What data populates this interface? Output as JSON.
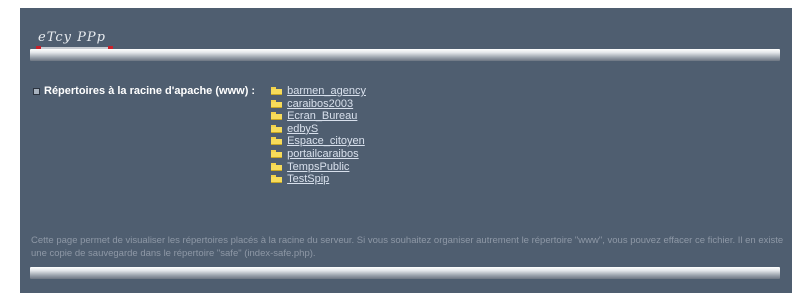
{
  "header": {
    "logo_text": "eTcy PPp",
    "colors": {
      "background": "#4f5e70",
      "accent": "#c8202a",
      "folder": "#f7dc5a"
    }
  },
  "main": {
    "section_label": "Répertoires à la racine d'apache (www) :",
    "directories": [
      {
        "label": "barmen_agency"
      },
      {
        "label": "caraibos2003"
      },
      {
        "label": "Ecran_Bureau"
      },
      {
        "label": "edbyS"
      },
      {
        "label": "Espace_citoyen"
      },
      {
        "label": "portailcaraibos"
      },
      {
        "label": "TempsPublic"
      },
      {
        "label": "TestSpip"
      }
    ]
  },
  "footer": {
    "note": "Cette page permet de visualiser les répertoires placés à la racine du serveur. Si vous souhaitez organiser autrement le répertoire \"www\", vous pouvez effacer ce fichier. Il en existe une copie de sauvegarde dans le répertoire \"safe\" (index-safe.php)."
  }
}
